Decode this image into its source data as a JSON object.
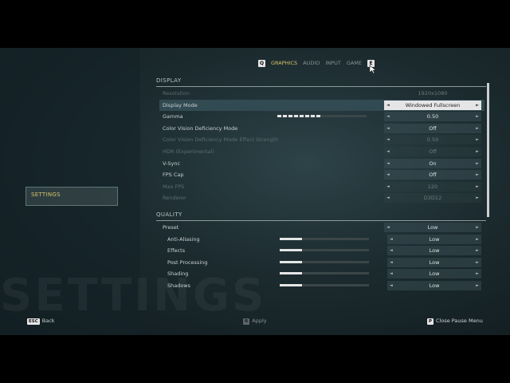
{
  "tabs": {
    "left_key": "Q",
    "right_key": "E",
    "items": [
      {
        "label": "GRAPHICS",
        "active": true
      },
      {
        "label": "AUDIO",
        "active": false
      },
      {
        "label": "INPUT",
        "active": false
      },
      {
        "label": "GAME",
        "active": false
      }
    ]
  },
  "sidebar": {
    "settings_label": "SETTINGS",
    "background_text": "SETTINGS"
  },
  "display": {
    "title": "DISPLAY",
    "rows": [
      {
        "label": "Resolution",
        "value": "1920x1080",
        "disabled": true
      },
      {
        "label": "Display Mode",
        "value": "Windowed Fullscreen",
        "selected": true
      },
      {
        "label": "Gamma",
        "value": "0.50",
        "slider": 0.5
      },
      {
        "label": "Color Vision Deficiency Mode",
        "value": "Off"
      },
      {
        "label": "Color Vision Deficiency Mode Effect Strength",
        "value": "0.50",
        "disabled": true
      },
      {
        "label": "HDR (Experimental)",
        "value": "Off",
        "disabled": true
      },
      {
        "label": "V-Sync",
        "value": "On"
      },
      {
        "label": "FPS Cap",
        "value": "Off"
      },
      {
        "label": "Max FPS",
        "value": "120",
        "disabled": true
      },
      {
        "label": "Renderer",
        "value": "D3D12",
        "disabled": true
      }
    ]
  },
  "quality": {
    "title": "QUALITY",
    "rows": [
      {
        "label": "Preset",
        "value": "Low"
      },
      {
        "label": "Anti-Aliasing",
        "value": "Low",
        "slider": 0.25
      },
      {
        "label": "Effects",
        "value": "Low",
        "slider": 0.25
      },
      {
        "label": "Post Processing",
        "value": "Low",
        "slider": 0.25
      },
      {
        "label": "Shading",
        "value": "Low",
        "slider": 0.25
      },
      {
        "label": "Shadows",
        "value": "Low",
        "slider": 0.25
      }
    ]
  },
  "footer": {
    "back_key": "ESC",
    "back_label": "Back",
    "apply_key": "R",
    "apply_label": "Apply",
    "close_key": "P",
    "close_label": "Close Pause Menu"
  },
  "colors": {
    "accent": "#d6c36a",
    "selected_row": "#324a52"
  }
}
